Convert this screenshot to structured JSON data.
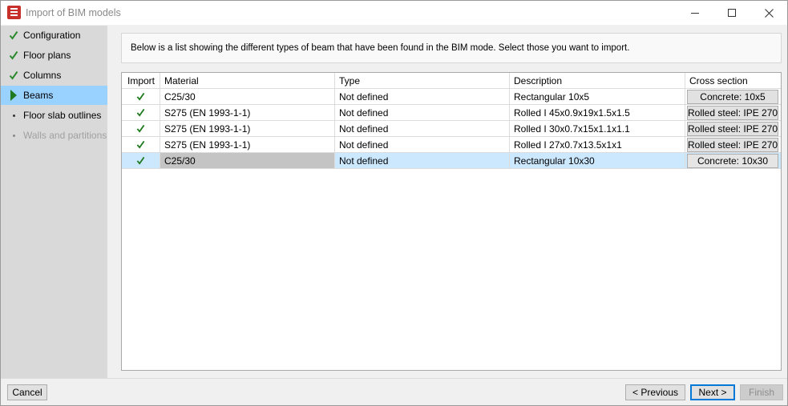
{
  "window": {
    "title": "Import of BIM models",
    "controls": [
      "minimize",
      "maximize",
      "close"
    ]
  },
  "sidebar": {
    "items": [
      {
        "label": "Configuration",
        "state": "done",
        "icon": "checkmark-icon"
      },
      {
        "label": "Floor plans",
        "state": "done",
        "icon": "checkmark-icon"
      },
      {
        "label": "Columns",
        "state": "done",
        "icon": "checkmark-icon"
      },
      {
        "label": "Beams",
        "state": "active",
        "icon": "arrow-right-icon"
      },
      {
        "label": "Floor slab outlines",
        "state": "pending",
        "icon": "bullet-icon"
      },
      {
        "label": "Walls and partitions",
        "state": "disabled",
        "icon": "bullet-icon"
      }
    ]
  },
  "info": {
    "text": "Below is a list showing the different types of beam that have been found in the BIM mode. Select those you want to import."
  },
  "table": {
    "columns": [
      "Import",
      "Material",
      "Type",
      "Description",
      "Cross section"
    ],
    "rows": [
      {
        "import": true,
        "material": "C25/30",
        "type": "Not defined",
        "description": "Rectangular 10x5",
        "cross_section": "Concrete: 10x5"
      },
      {
        "import": true,
        "material": "S275 (EN 1993-1-1)",
        "type": "Not defined",
        "description": "Rolled I 45x0.9x19x1.5x1.5",
        "cross_section": "Rolled steel: IPE 270"
      },
      {
        "import": true,
        "material": "S275 (EN 1993-1-1)",
        "type": "Not defined",
        "description": "Rolled I 30x0.7x15x1.1x1.1",
        "cross_section": "Rolled steel: IPE 270"
      },
      {
        "import": true,
        "material": "S275 (EN 1993-1-1)",
        "type": "Not defined",
        "description": "Rolled I 27x0.7x13.5x1x1",
        "cross_section": "Rolled steel: IPE 270"
      },
      {
        "import": true,
        "material": "C25/30",
        "type": "Not defined",
        "description": "Rectangular 10x30",
        "cross_section": "Concrete: 10x30",
        "selected": true
      }
    ]
  },
  "footer": {
    "cancel": "Cancel",
    "previous": "< Previous",
    "next": "Next >",
    "finish": "Finish"
  },
  "colors": {
    "check_green": "#2c8a2c",
    "active_nav": "#99d1ff",
    "selected_row": "#cce8ff"
  }
}
